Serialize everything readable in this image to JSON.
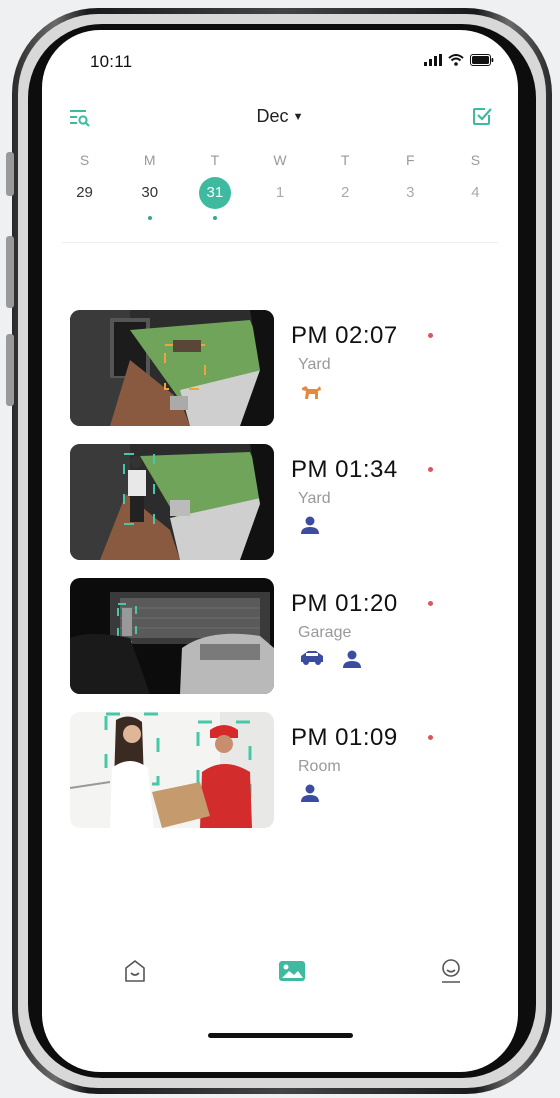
{
  "status_bar": {
    "time": "10:11"
  },
  "header": {
    "month": "Dec"
  },
  "calendar": {
    "weekdays": [
      "S",
      "M",
      "T",
      "W",
      "T",
      "F",
      "S"
    ],
    "days": [
      "29",
      "30",
      "31",
      "1",
      "2",
      "3",
      "4"
    ]
  },
  "events": [
    {
      "time": "PM  02:07",
      "location": "Yard",
      "detections": [
        "dog-icon"
      ]
    },
    {
      "time": "PM  01:34",
      "location": "Yard",
      "detections": [
        "person-icon"
      ]
    },
    {
      "time": "PM  01:20",
      "location": "Garage",
      "detections": [
        "car-icon",
        "person-icon"
      ]
    },
    {
      "time": "PM  01:09",
      "location": "Room",
      "detections": [
        "person-icon"
      ]
    }
  ],
  "nav": {
    "items": [
      "home-icon",
      "gallery-icon",
      "profile-icon"
    ],
    "active": "gallery-icon"
  },
  "colors": {
    "accent": "#3dbaa0",
    "event_dot": "#d8565f",
    "person_icon": "#3c4c9e",
    "dog_icon": "#e48a3a"
  }
}
